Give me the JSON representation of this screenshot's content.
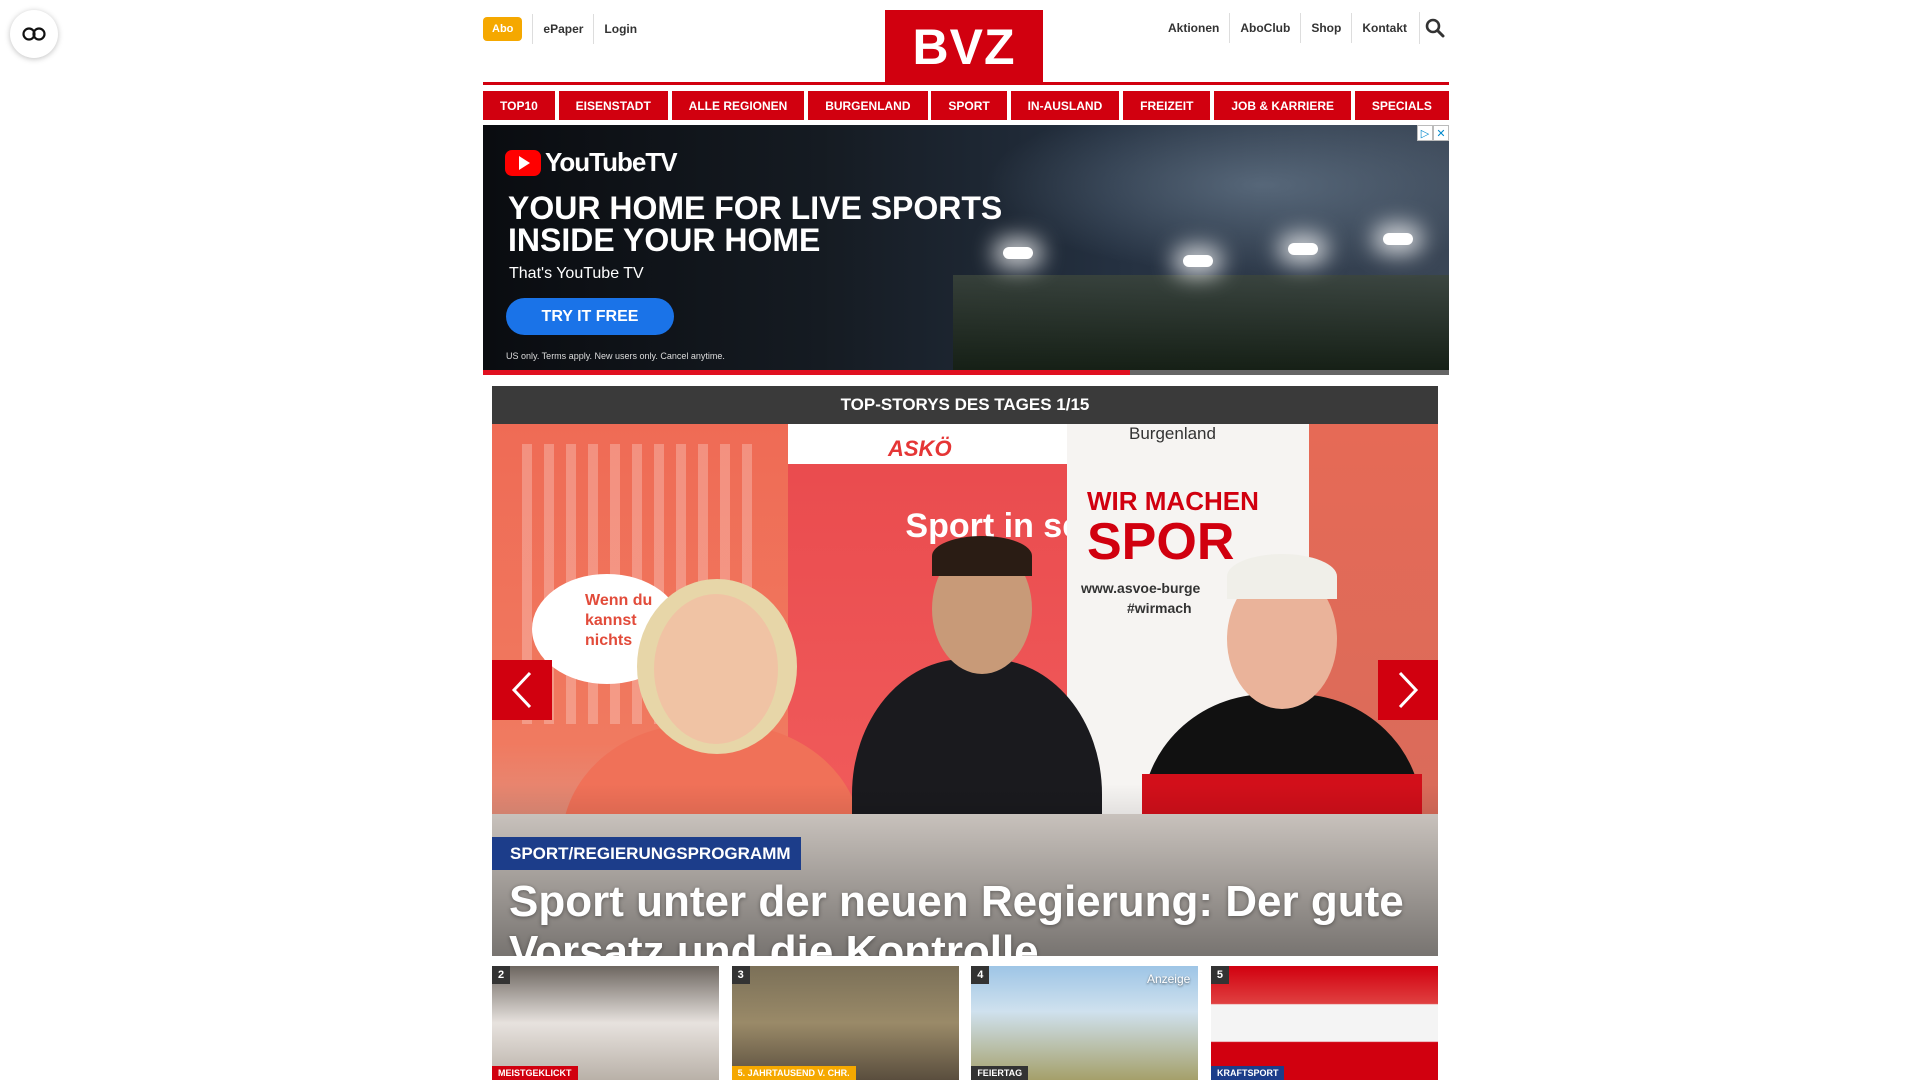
{
  "header": {
    "abo_label": "Abo",
    "left_links": [
      "ePaper",
      "Login"
    ],
    "logo_text": "BVZ",
    "right_links": [
      "Aktionen",
      "AboClub",
      "Shop",
      "Kontakt"
    ],
    "search_icon": "search-icon",
    "brand_color": "#d1000f"
  },
  "nav": {
    "items": [
      "TOP10",
      "EISENSTADT",
      "ALLE REGIONEN",
      "BURGENLAND",
      "SPORT",
      "IN-AUSLAND",
      "FREIZEIT",
      "JOB & KARRIERE",
      "SPECIALS"
    ]
  },
  "ad": {
    "brand": "YouTubeTV",
    "headline": "YOUR HOME FOR LIVE SPORTS INSIDE YOUR HOME",
    "subline": "That's YouTube TV",
    "cta": "TRY IT FREE",
    "fine_print": "US only. Terms apply. New users only. Cancel anytime.",
    "progress": 0.67,
    "cta_color": "#1a73e8"
  },
  "top_stories": {
    "title": "TOP-STORYS DES TAGES 1/15",
    "category": "SPORT/REGIERUNGSPROGRAMM",
    "headline": "Sport unter der neuen Regierung: Der gute Vorsatz und die Kontrolle",
    "category_color": "#1c3d8a",
    "photo_texts": {
      "bubble": "Wenn du kannst nichts",
      "asko": "ASKÖ",
      "sport_banner": "Sport in sei Vie",
      "burgenland": "Burgenland",
      "wir_machen": "WIR MACHEN",
      "spor": "SPOR",
      "url": "www.asvoe-burge",
      "hashtag": "#wirmach"
    }
  },
  "thumbnails": [
    {
      "number": "2",
      "category": "MEISTGEKLICKT",
      "category_color": "#d1000f",
      "ad_label": ""
    },
    {
      "number": "3",
      "category": "5. JAHRTAUSEND V. CHR.",
      "category_color": "#f5a800",
      "ad_label": ""
    },
    {
      "number": "4",
      "category": "FEIERTAG",
      "category_color": "#333333",
      "ad_label": "Anzeige"
    },
    {
      "number": "5",
      "category": "KRAFTSPORT",
      "category_color": "#1c3d8a",
      "ad_label": ""
    }
  ]
}
